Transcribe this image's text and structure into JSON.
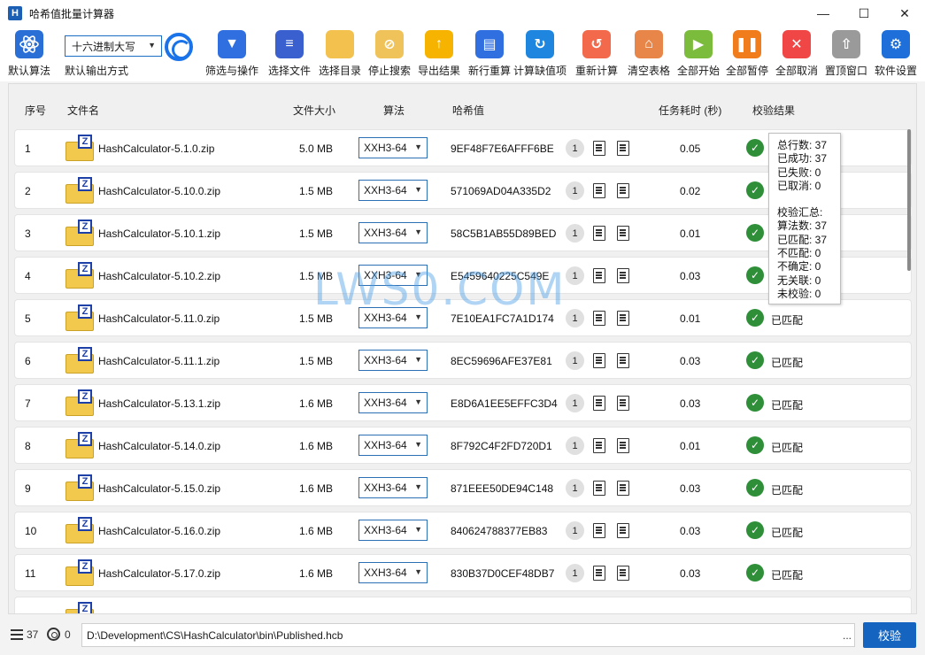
{
  "window": {
    "app_icon_letter": "H",
    "title": "哈希值批量计算器",
    "minimize": "—",
    "maximize": "☐",
    "close": "✕"
  },
  "toolbar": {
    "default_algo_label": "默认算法",
    "output_mode_value": "十六进制大写",
    "output_mode_label": "默认输出方式",
    "buttons": [
      {
        "label": "筛选与操作",
        "icon": "filter-icon",
        "color": "#2f6fe0"
      },
      {
        "label": "选择文件",
        "icon": "file-list-icon",
        "color": "#3a5fcf"
      },
      {
        "label": "选择目录",
        "icon": "folder-icon",
        "color": "#f2c14e"
      },
      {
        "label": "停止搜索",
        "icon": "stop-icon",
        "color": "#f0c35a"
      },
      {
        "label": "导出结果",
        "icon": "export-icon",
        "color": "#f6b400"
      },
      {
        "label": "新行重算",
        "icon": "new-row-icon",
        "color": "#2f6fe0"
      },
      {
        "label": "计算缺值项",
        "icon": "refresh-icon",
        "color": "#1f86e0"
      },
      {
        "label": "重新计算",
        "icon": "recalc-icon",
        "color": "#f26a4b"
      },
      {
        "label": "清空表格",
        "icon": "basket-icon",
        "color": "#e8864a"
      },
      {
        "label": "全部开始",
        "icon": "play-icon",
        "color": "#7cbc3c"
      },
      {
        "label": "全部暂停",
        "icon": "pause-icon",
        "color": "#f07c1c"
      },
      {
        "label": "全部取消",
        "icon": "cancel-icon",
        "color": "#f04646"
      },
      {
        "label": "置顶窗口",
        "icon": "pin-top-icon",
        "color": "#9a9a9a"
      },
      {
        "label": "软件设置",
        "icon": "gear-icon",
        "color": "#1e6fd9"
      }
    ]
  },
  "table": {
    "headers": {
      "index": "序号",
      "filename": "文件名",
      "size": "文件大小",
      "algorithm": "算法",
      "hash": "哈希值",
      "duration": "任务耗时 (秒)",
      "verify": "校验结果"
    },
    "rows": [
      {
        "index": "1",
        "filename": "HashCalculator-5.1.0.zip",
        "size": "5.0 MB",
        "algorithm": "XXH3-64",
        "hash": "9EF48F7E6AFFF6BE",
        "count": "1",
        "duration": "0.05",
        "status": ""
      },
      {
        "index": "2",
        "filename": "HashCalculator-5.10.0.zip",
        "size": "1.5 MB",
        "algorithm": "XXH3-64",
        "hash": "571069AD04A335D2",
        "count": "1",
        "duration": "0.02",
        "status": ""
      },
      {
        "index": "3",
        "filename": "HashCalculator-5.10.1.zip",
        "size": "1.5 MB",
        "algorithm": "XXH3-64",
        "hash": "58C5B1AB55D89BED",
        "count": "1",
        "duration": "0.01",
        "status": ""
      },
      {
        "index": "4",
        "filename": "HashCalculator-5.10.2.zip",
        "size": "1.5 MB",
        "algorithm": "XXH3-64",
        "hash": "E5459640225C549E",
        "count": "1",
        "duration": "0.03",
        "status": ""
      },
      {
        "index": "5",
        "filename": "HashCalculator-5.11.0.zip",
        "size": "1.5 MB",
        "algorithm": "XXH3-64",
        "hash": "7E10EA1FC7A1D174",
        "count": "1",
        "duration": "0.01",
        "status": "已匹配"
      },
      {
        "index": "6",
        "filename": "HashCalculator-5.11.1.zip",
        "size": "1.5 MB",
        "algorithm": "XXH3-64",
        "hash": "8EC59696AFE37E81",
        "count": "1",
        "duration": "0.03",
        "status": "已匹配"
      },
      {
        "index": "7",
        "filename": "HashCalculator-5.13.1.zip",
        "size": "1.6 MB",
        "algorithm": "XXH3-64",
        "hash": "E8D6A1EE5EFFC3D4",
        "count": "1",
        "duration": "0.03",
        "status": "已匹配"
      },
      {
        "index": "8",
        "filename": "HashCalculator-5.14.0.zip",
        "size": "1.6 MB",
        "algorithm": "XXH3-64",
        "hash": "8F792C4F2FD720D1",
        "count": "1",
        "duration": "0.01",
        "status": "已匹配"
      },
      {
        "index": "9",
        "filename": "HashCalculator-5.15.0.zip",
        "size": "1.6 MB",
        "algorithm": "XXH3-64",
        "hash": "871EEE50DE94C148",
        "count": "1",
        "duration": "0.03",
        "status": "已匹配"
      },
      {
        "index": "10",
        "filename": "HashCalculator-5.16.0.zip",
        "size": "1.6 MB",
        "algorithm": "XXH3-64",
        "hash": "840624788377EB83",
        "count": "1",
        "duration": "0.03",
        "status": "已匹配"
      },
      {
        "index": "11",
        "filename": "HashCalculator-5.17.0.zip",
        "size": "1.6 MB",
        "algorithm": "XXH3-64",
        "hash": "830B37D0CEF48DB7",
        "count": "1",
        "duration": "0.03",
        "status": "已匹配"
      }
    ]
  },
  "tooltip": {
    "lines_a": [
      "总行数: 37",
      "已成功: 37",
      "已失败: 0",
      "已取消: 0"
    ],
    "lines_b": [
      "校验汇总:",
      "算法数: 37",
      "已匹配: 37",
      "不匹配: 0",
      "不确定: 0",
      "无关联: 0",
      "未校验: 0"
    ]
  },
  "watermark": "LWS0.COM",
  "bottom": {
    "row_count": "37",
    "target_count": "0",
    "path": "D:\\Development\\CS\\HashCalculator\\bin\\Published.hcb",
    "dots": "...",
    "verify_button": "校验"
  }
}
